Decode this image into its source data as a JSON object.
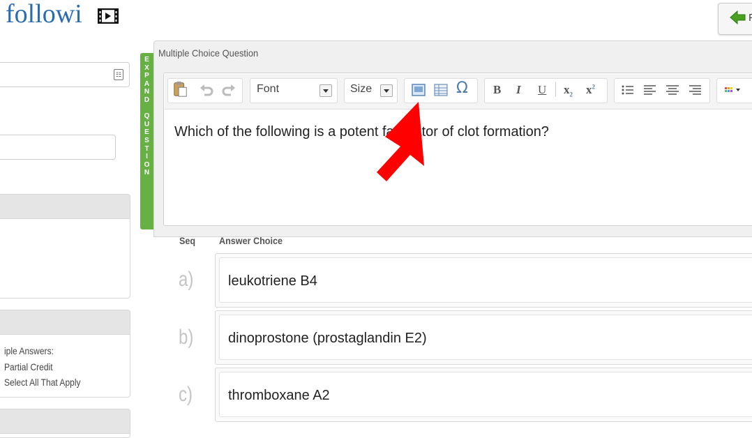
{
  "header": {
    "title": "followi",
    "back_button_label": "F"
  },
  "colors": {
    "title_blue": "#2a6cb0",
    "expand_tab_green": "#66b044",
    "annotation_arrow_red": "#ff0000",
    "back_arrow_green": "#4aa020"
  },
  "expand_tab": {
    "letters": [
      "E",
      "X",
      "P",
      "A",
      "N",
      "D",
      " ",
      "Q",
      "U",
      "E",
      "S",
      "T",
      "I",
      "O",
      "N"
    ]
  },
  "question_panel": {
    "heading": "Multiple Choice Question",
    "question_text": "Which of the following is a potent facilitator of clot formation?"
  },
  "toolbar": {
    "font_label": "Font",
    "size_label": "Size",
    "bold": "B",
    "italic": "I",
    "underline": "U",
    "subscript": "x",
    "subscript_mark": "2",
    "superscript": "x",
    "superscript_mark": "2",
    "icons": [
      "paste-icon",
      "undo-icon",
      "redo-icon",
      "image-icon",
      "table-icon",
      "special-char-icon",
      "bullet-list-icon",
      "align-left-icon",
      "align-center-icon",
      "align-right-icon",
      "color-grid-icon"
    ]
  },
  "answers": {
    "seq_header": "Seq",
    "choice_header": "Answer Choice",
    "rows": [
      {
        "seq": "a)",
        "text": "leukotriene B4"
      },
      {
        "seq": "b)",
        "text": "dinoprostone (prostaglandin E2)"
      },
      {
        "seq": "c)",
        "text": "thromboxane A2"
      }
    ]
  },
  "sidebar": {
    "options": [
      "iple Answers:",
      "Partial Credit",
      "Select All That Apply"
    ]
  }
}
